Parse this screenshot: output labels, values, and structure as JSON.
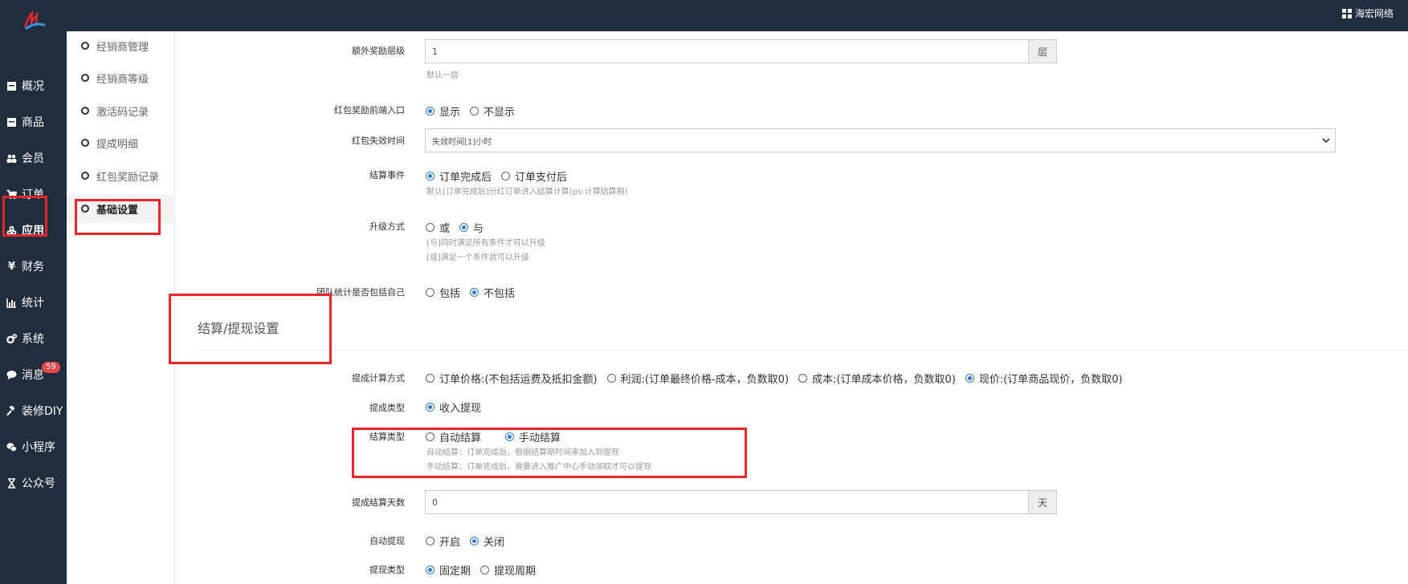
{
  "header": {
    "brand": "海宏网络"
  },
  "nav": {
    "items": [
      {
        "label": "概况",
        "icon": "file-icon"
      },
      {
        "label": "商品",
        "icon": "box-icon"
      },
      {
        "label": "会员",
        "icon": "users-icon"
      },
      {
        "label": "订单",
        "icon": "cart-icon"
      },
      {
        "label": "应用",
        "icon": "apps-icon"
      },
      {
        "label": "财务",
        "icon": "yen-icon"
      },
      {
        "label": "统计",
        "icon": "bar-chart-icon"
      },
      {
        "label": "系统",
        "icon": "gears-icon"
      },
      {
        "label": "消息",
        "icon": "comment-icon"
      },
      {
        "label": "装修DIY",
        "icon": "gavel-icon"
      },
      {
        "label": "小程序",
        "icon": "wechat-icon"
      },
      {
        "label": "公众号",
        "icon": "hourglass-icon"
      }
    ],
    "message_badge": "59"
  },
  "subnav": {
    "items": [
      "经销商管理",
      "经销商等级",
      "激活码记录",
      "提成明细",
      "红包奖励记录",
      "基础设置"
    ]
  },
  "form": {
    "extra_reward_level": {
      "label": "额外奖励层级",
      "value": "1",
      "addon": "层",
      "help": "默认一层"
    },
    "redpacket_entry": {
      "label": "红包奖励前端入口",
      "options": [
        "显示",
        "不显示"
      ]
    },
    "redpacket_expire": {
      "label": "红包失效时间",
      "selected": "失效时间[1]小时"
    },
    "settle_event": {
      "label": "结算事件",
      "options": [
        "订单完成后",
        "订单支付后"
      ],
      "help": "默认[订单完成后]分红订单进入结算计算(ps:计算结算期)"
    },
    "upgrade_mode": {
      "label": "升级方式",
      "options": [
        "或",
        "与"
      ],
      "help1": "[与]同时满足所有条件才可以升级",
      "help2": "[或]满足一个条件就可以升级"
    },
    "team_stats": {
      "label": "团队统计是否包括自己",
      "options": [
        "包括",
        "不包括"
      ]
    },
    "section_title": "结算/提现设置",
    "commission_calc": {
      "label": "提成计算方式",
      "options": [
        "订单价格:(不包括运费及抵扣金额)",
        "利润:(订单最终价格-成本，负数取0)",
        "成本:(订单成本价格，负数取0)",
        "现价:(订单商品现价，负数取0)"
      ]
    },
    "commission_type": {
      "label": "提成类型",
      "options": [
        "收入提现"
      ]
    },
    "settle_type": {
      "label": "结算类型",
      "options": [
        "自动结算",
        "手动结算"
      ],
      "help1": "自动结算：订单完成后，根据结算期时间来加入到提现",
      "help2": "手动结算：订单完成后，需要进入推广中心手动领取才可以提现"
    },
    "settle_days": {
      "label": "提成结算天数",
      "value": "0",
      "addon": "天"
    },
    "auto_withdraw": {
      "label": "自动提现",
      "options": [
        "开启",
        "关闭"
      ]
    },
    "withdraw_type": {
      "label": "提现类型",
      "options": [
        "固定期",
        "提现周期"
      ]
    }
  },
  "colors": {
    "sidebar": "#1f2d3d",
    "accent": "#2f7bd6",
    "highlight": "#e8262b",
    "badge": "#e5474a"
  }
}
